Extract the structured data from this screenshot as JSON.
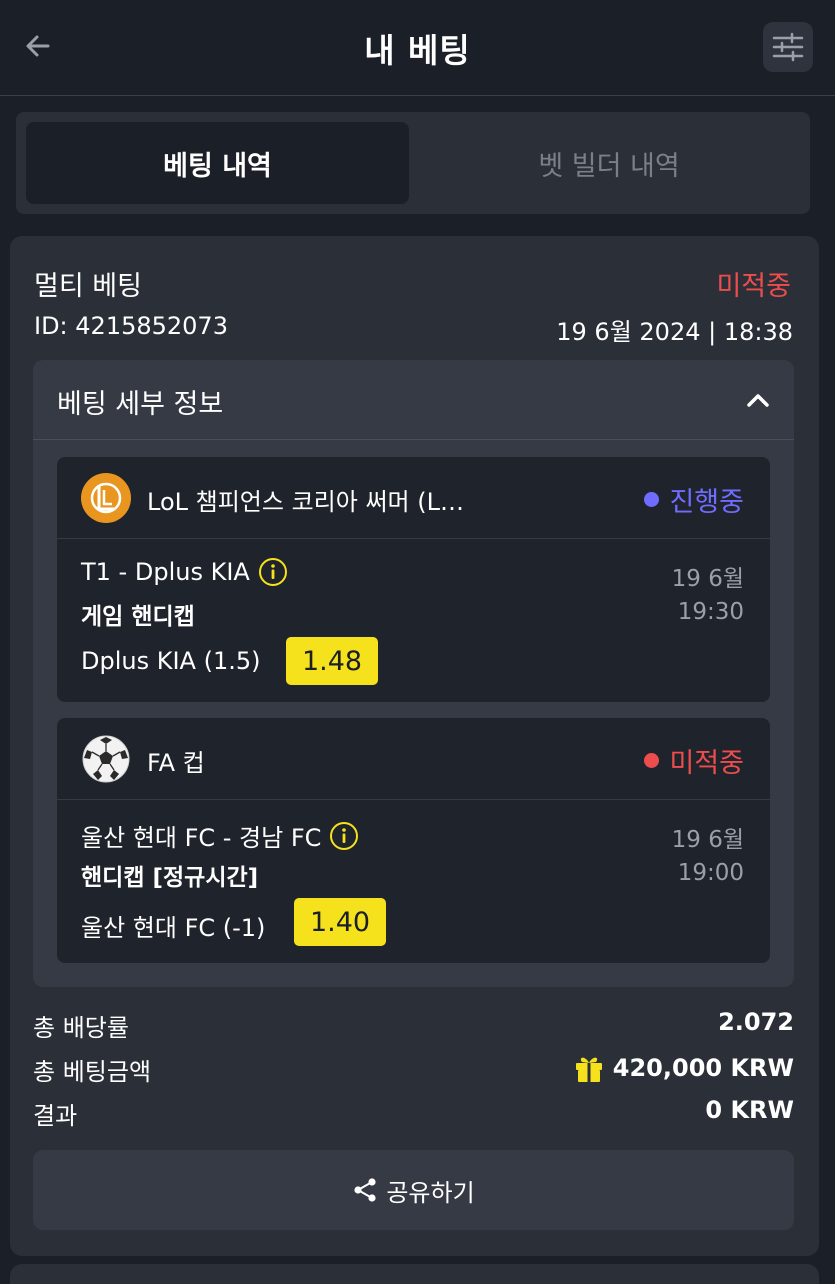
{
  "header": {
    "title": "내 베팅",
    "back_icon": "arrow-left-icon",
    "filter_icon": "sliders-icon"
  },
  "tabs": [
    {
      "label": "베팅 내역",
      "active": true
    },
    {
      "label": "벳 빌더 내역",
      "active": false
    }
  ],
  "bet": {
    "type": "멀티 베팅",
    "status": "미적중",
    "status_color": "#ee4d4d",
    "id": "ID: 4215852073",
    "datetime": "19 6월 2024 | 18:38",
    "details_title": "베팅 세부 정보",
    "selections": [
      {
        "league": "LoL 챔피언스 코리아 써머 (L…",
        "league_icon": "lol-icon",
        "state": "진행중",
        "state_color": "#6f6cff",
        "match": "T1 - Dplus KIA",
        "market": "게임 핸디캡",
        "pick": "Dplus KIA (1.5)",
        "odds": "1.48",
        "date": "19 6월",
        "time": "19:30"
      },
      {
        "league": "FA 컵",
        "league_icon": "soccer-ball-icon",
        "state": "미적중",
        "state_color": "#ee4d4d",
        "match": "울산 현대 FC - 경남 FC",
        "market": "핸디캡 [정규시간]",
        "pick": "울산 현대 FC (-1)",
        "odds": "1.40",
        "date": "19 6월",
        "time": "19:00"
      }
    ],
    "summary": {
      "total_odds_label": "총 배당률",
      "total_odds": "2.072",
      "total_stake_label": "총 베팅금액",
      "total_stake": "420,000 KRW",
      "result_label": "결과",
      "result": "0 KRW"
    },
    "share_label": "공유하기"
  },
  "colors": {
    "background": "#1b1f27",
    "card": "#2a2f38",
    "odds_highlight": "#f6e21c"
  }
}
